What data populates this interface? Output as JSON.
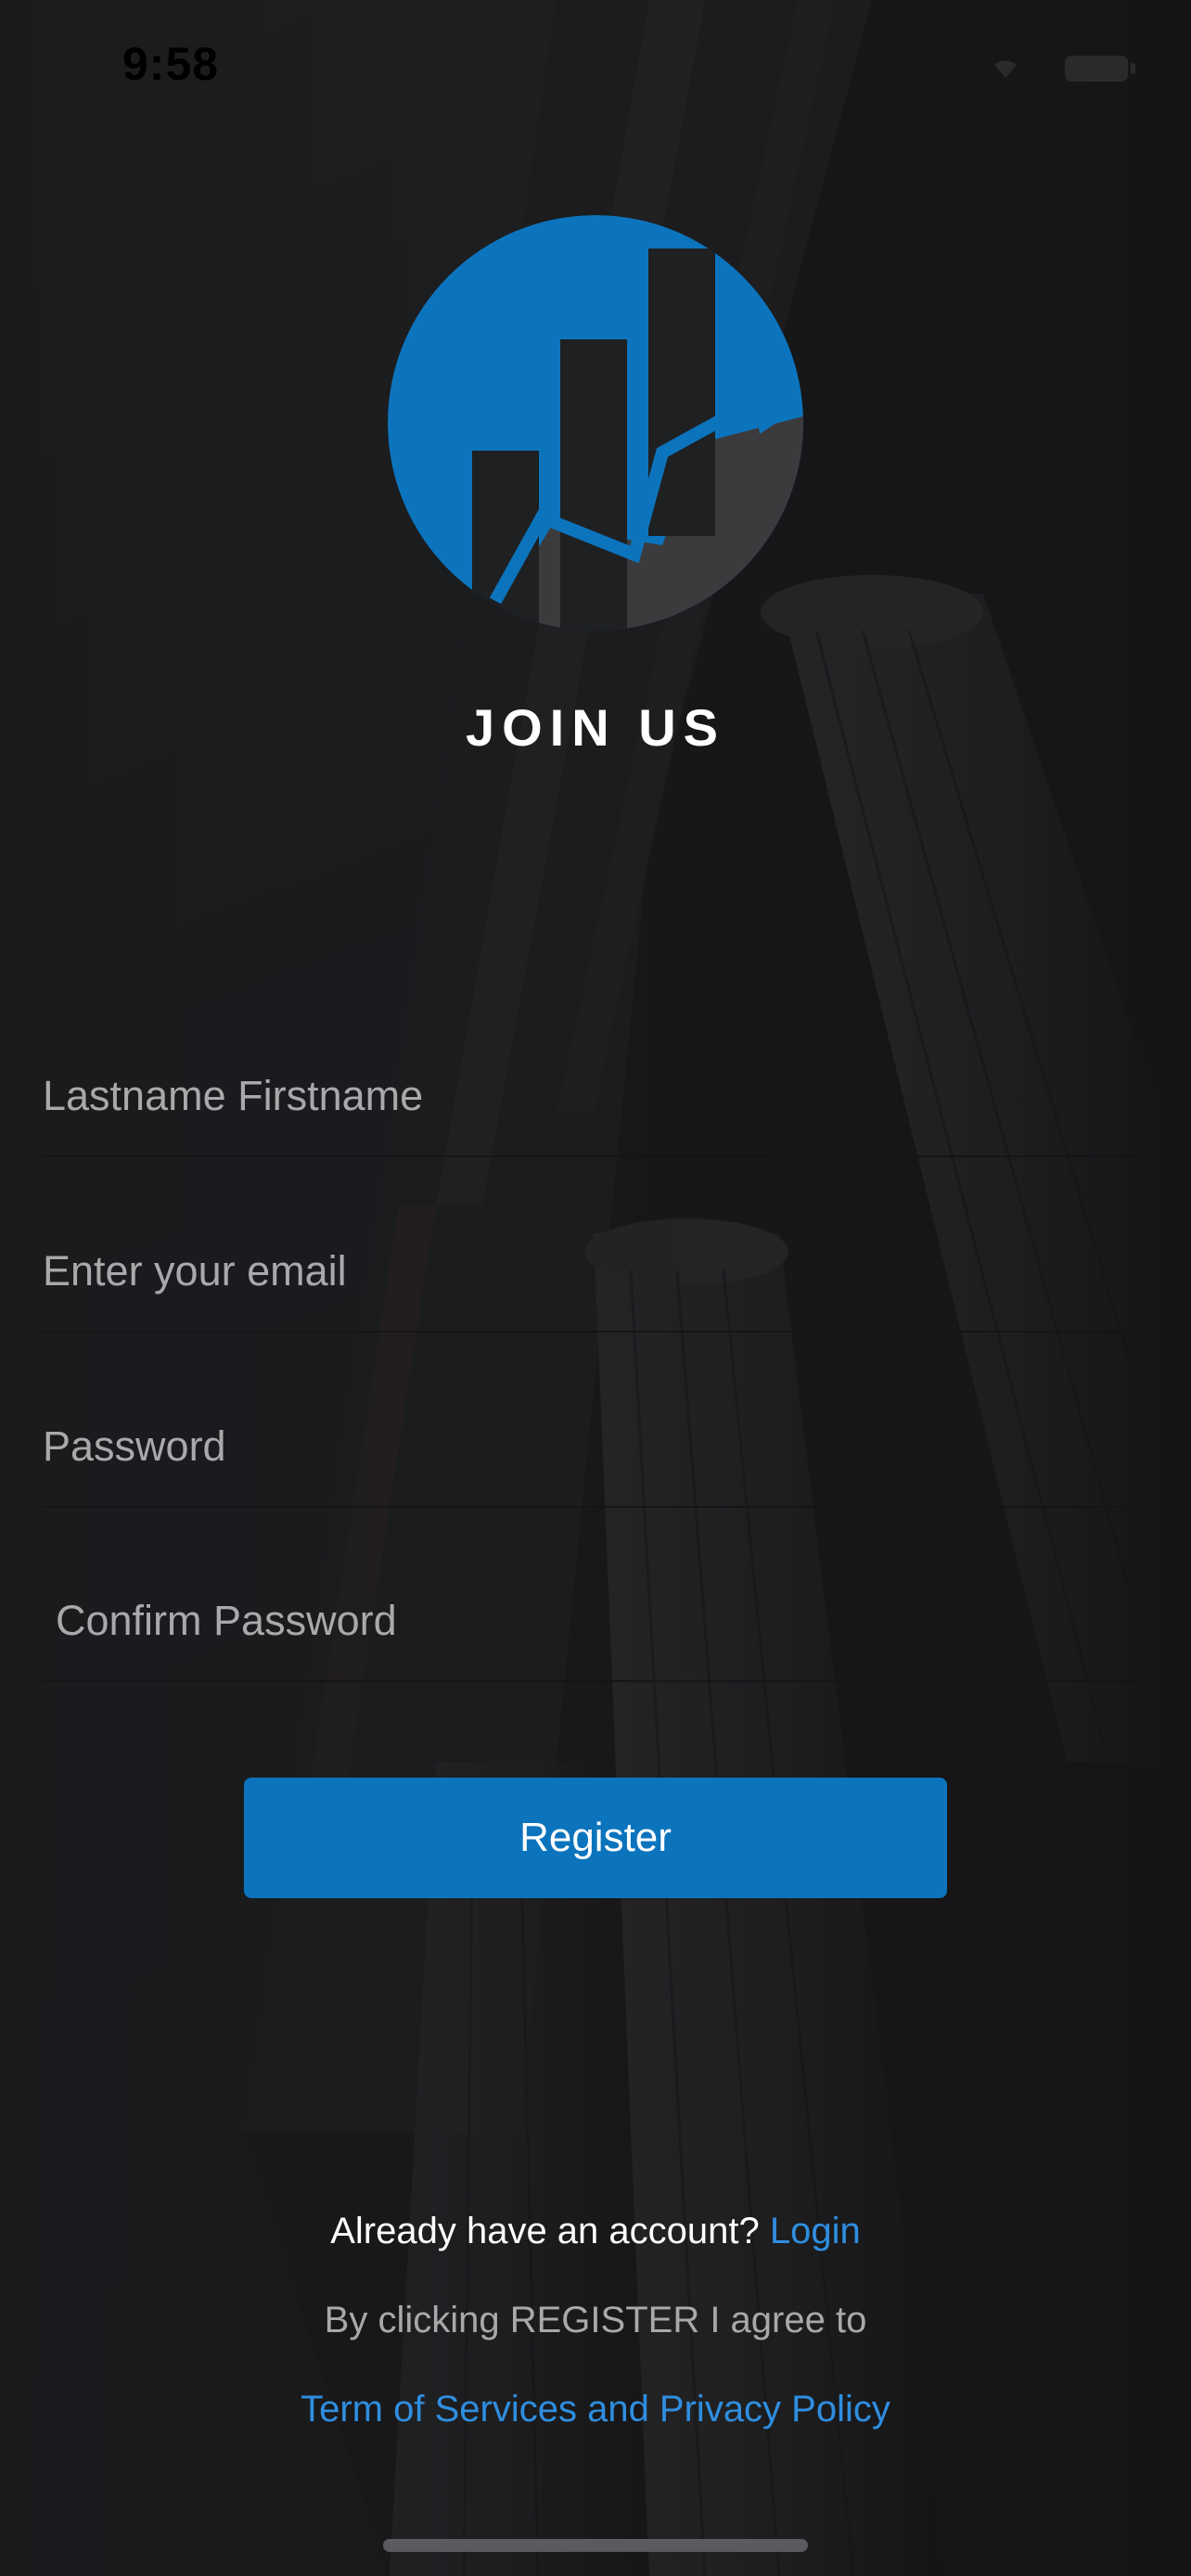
{
  "status_bar": {
    "time": "9:58",
    "icons": [
      "wifi-icon",
      "battery-icon"
    ]
  },
  "branding": {
    "logo_icon": "rising-bar-chart-logo",
    "title": "JOIN US",
    "accent_color": "#0c74bd"
  },
  "form": {
    "name_placeholder": "Lastname Firstname",
    "name_value": "",
    "email_placeholder": "Enter your email",
    "email_value": "",
    "password_placeholder": "Password",
    "password_value": "",
    "confirm_placeholder": "Confirm Password",
    "confirm_value": "",
    "register_label": "Register"
  },
  "footer": {
    "already_text": "Already have an account?",
    "login_link": "Login",
    "agree_text": "By clicking REGISTER I agree to",
    "terms_link": "Term of Services and Privacy Policy",
    "link_color": "#2f8ee0"
  }
}
